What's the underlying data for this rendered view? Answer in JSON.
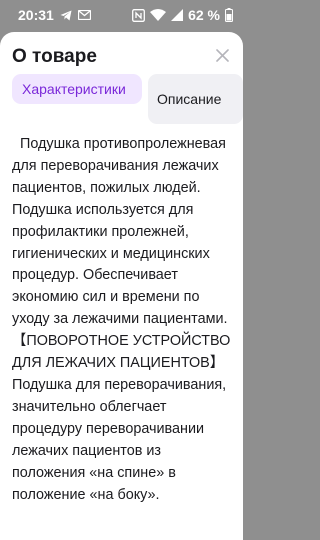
{
  "status_bar": {
    "time": "20:31",
    "battery_percent": "62 %",
    "icons": [
      "telegram-icon",
      "email-icon",
      "nfc-icon",
      "wifi-icon",
      "signal-icon",
      "battery-icon"
    ]
  },
  "sheet": {
    "title": "О товаре",
    "close_icon": "close-icon",
    "tabs": [
      {
        "label": "Характеристики",
        "active": true
      },
      {
        "label": "Описание",
        "active": false
      }
    ],
    "description": "  Подушка противопролежневая для переворачивания лежачих пациентов, пожилых людей. Подушка используется для профилактики пролежней, гигиенических и медицинских процедур. Обеспечивает экономию сил и времени по уходу за лежачими пациентами.  【ПОВОРОТНОЕ УСТРОЙСТВО ДЛЯ ЛЕЖАЧИХ ПАЦИЕНТОВ】 Подушка для переворачивания, значительно облегчает процедуру переворачивании лежачих пациентов из положения «на спине» в положение «на боку»."
  },
  "colors": {
    "accent": "#7a28d9",
    "active_tab_bg": "#f0e6ff",
    "inactive_tab_bg": "#f0f0f4",
    "backdrop": "#8f8f8f"
  }
}
